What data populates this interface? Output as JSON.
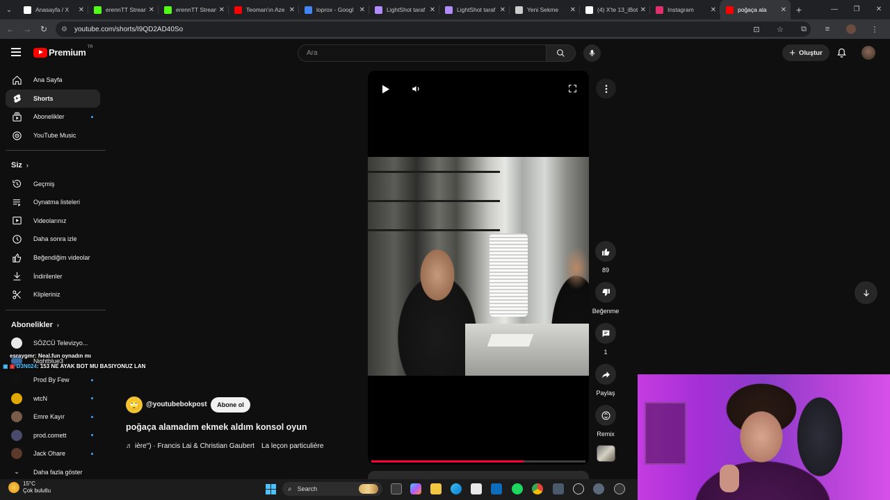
{
  "browser": {
    "tabs": [
      {
        "title": "Anasayfa / X",
        "icon": "x-logo",
        "color": "#ffffff"
      },
      {
        "title": "erennTT Stream",
        "icon": "kick-logo",
        "color": "#53fc18"
      },
      {
        "title": "erennTT Stream",
        "icon": "kick-logo",
        "color": "#53fc18"
      },
      {
        "title": "Teoman'ın Aze",
        "icon": "youtube-logo",
        "color": "#ff0000"
      },
      {
        "title": "loprox - Googl",
        "icon": "google-logo",
        "color": "#4285f4"
      },
      {
        "title": "LightShot taraf",
        "icon": "lightshot-icon",
        "color": "#b18cff"
      },
      {
        "title": "LightShot taraf",
        "icon": "lightshot-icon",
        "color": "#b18cff"
      },
      {
        "title": "Yeni Sekme",
        "icon": "chrome-icon",
        "color": "#cccccc"
      },
      {
        "title": "(4) X'te 13_iBot",
        "icon": "x-logo",
        "color": "#ffffff"
      },
      {
        "title": "Instagram",
        "icon": "instagram-logo",
        "color": "#e1306c"
      },
      {
        "title": "poğaça ala",
        "icon": "youtube-logo",
        "color": "#ff0000",
        "active": true
      }
    ],
    "url": "youtube.com/shorts/I9QD2AD40So"
  },
  "header": {
    "logo_text": "Premium",
    "country_code": "TR",
    "search_placeholder": "Ara",
    "create_label": "Oluştur"
  },
  "sidebar": {
    "main": [
      {
        "label": "Ana Sayfa",
        "icon": "home-icon"
      },
      {
        "label": "Shorts",
        "icon": "shorts-icon",
        "active": true
      },
      {
        "label": "Abonelikler",
        "icon": "subscriptions-icon",
        "dot": true
      },
      {
        "label": "YouTube Music",
        "icon": "youtube-music-icon"
      }
    ],
    "you_heading": "Siz",
    "you": [
      {
        "label": "Geçmiş",
        "icon": "history-icon"
      },
      {
        "label": "Oynatma listeleri",
        "icon": "playlists-icon"
      },
      {
        "label": "Videolarınız",
        "icon": "your-videos-icon"
      },
      {
        "label": "Daha sonra izle",
        "icon": "watch-later-icon"
      },
      {
        "label": "Beğendiğim videolar",
        "icon": "liked-icon"
      },
      {
        "label": "İndirilenler",
        "icon": "download-icon"
      },
      {
        "label": "Klipleriniz",
        "icon": "clips-icon"
      }
    ],
    "subs_heading": "Abonelikler",
    "subs": [
      {
        "label": "SÖZCÜ Televizyo...",
        "color": "#e8e8e8"
      },
      {
        "label": "Nightblue3",
        "color": "#3a6ea5"
      },
      {
        "label": "Prod By Few",
        "color": "#111111",
        "dot": true
      },
      {
        "label": "wtcN",
        "color": "#e0a800",
        "dot": true
      },
      {
        "label": "Emre Kayır",
        "color": "#7a5a48",
        "dot": true
      },
      {
        "label": "prod.comett",
        "color": "#4a4a6a",
        "dot": true
      },
      {
        "label": "Jack Ohare",
        "color": "#5a3a2a",
        "dot": true
      }
    ],
    "show_more": "Daha fazla göster"
  },
  "chat_overlay": [
    {
      "user": "esraygmr",
      "text": ": Neal.fun oynadın mı"
    },
    {
      "user": "D3N024",
      "text": ": 153 NE AYAK BOT MU BASIYONUZ LAN"
    }
  ],
  "short": {
    "channel": "@youtubebokpost",
    "subscribe_label": "Abone ol",
    "title": "poğaça alamadım ekmek aldım konsol oyun",
    "music_main": "ière\") · Francis Lai & Christian Gaubert",
    "music_secondary": "La leçon particulière",
    "progress": 0.71
  },
  "actions": {
    "likes": "89",
    "dislike_label": "Beğenme",
    "comments": "1",
    "share_label": "Paylaş",
    "remix_label": "Remix"
  },
  "taskbar": {
    "temperature": "15°C",
    "weather": "Çok bulutlu",
    "search_label": "Search"
  }
}
